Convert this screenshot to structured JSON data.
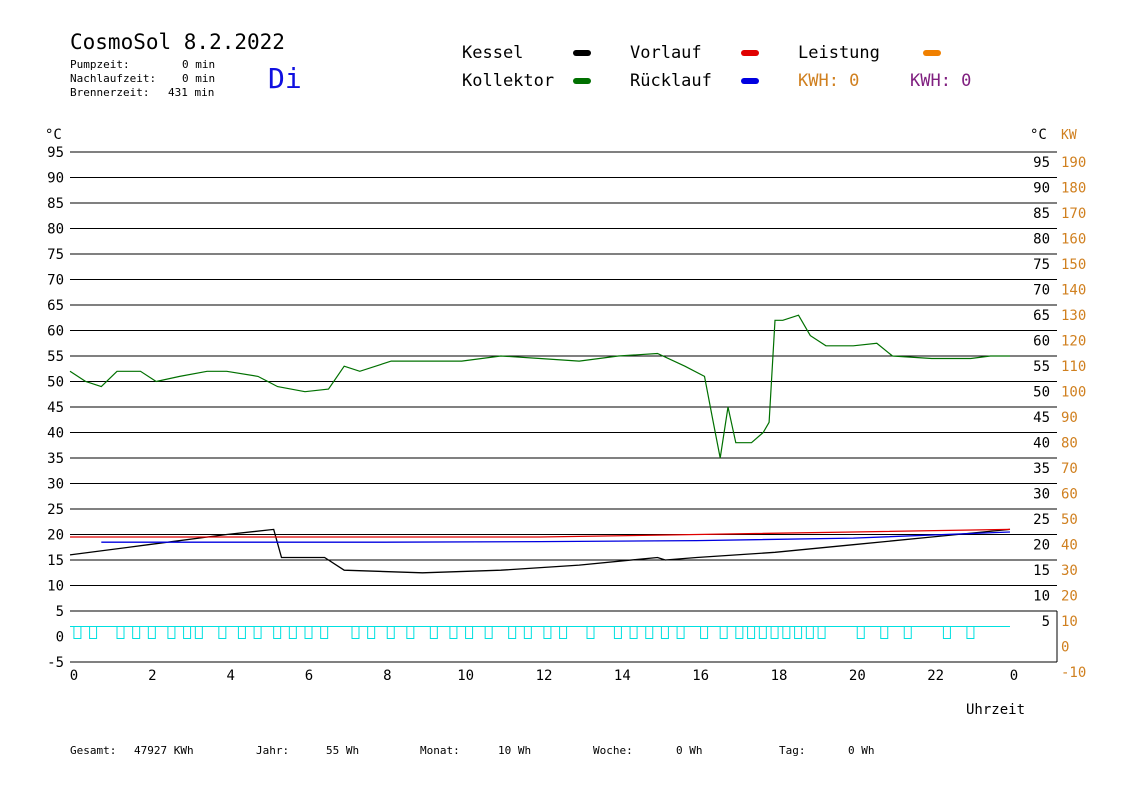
{
  "header": {
    "title": "CosmoSol 8.2.2022",
    "day": "Di",
    "stats": [
      {
        "label": "Pumpzeit:",
        "value": "0 min"
      },
      {
        "label": "Nachlaufzeit:",
        "value": "0 min"
      },
      {
        "label": "Brennerzeit:",
        "value": "431 min"
      }
    ]
  },
  "legend": {
    "kessel": {
      "label": "Kessel",
      "color": "#000000"
    },
    "vorlauf": {
      "label": "Vorlauf",
      "color": "#e00000"
    },
    "leistung": {
      "label": "Leistung",
      "color": "#f08000"
    },
    "kollektor": {
      "label": "Kollektor",
      "color": "#007000"
    },
    "ruecklauf": {
      "label": "Rücklauf",
      "color": "#0000e0"
    },
    "kwh1": {
      "label": "KWH: 0",
      "color": "#d08020"
    },
    "kwh2": {
      "label": "KWH: 0",
      "color": "#802080"
    }
  },
  "footer": [
    {
      "label": "Gesamt:",
      "value": "47927 KWh"
    },
    {
      "label": "Jahr:",
      "value": "55 Wh"
    },
    {
      "label": "Monat:",
      "value": "10 Wh"
    },
    {
      "label": "Woche:",
      "value": "0 Wh"
    },
    {
      "label": "Tag:",
      "value": "0 Wh"
    }
  ],
  "chart_data": {
    "type": "line",
    "xlabel": "Uhrzeit",
    "ylabel_left": "°C",
    "ylabel_right_1": "°C",
    "ylabel_right_2": "KW",
    "xlim": [
      0,
      24
    ],
    "ylim": [
      -5,
      100
    ],
    "x_ticks": [
      "0",
      "2",
      "4",
      "6",
      "8",
      "10",
      "12",
      "14",
      "16",
      "18",
      "20",
      "22",
      "0"
    ],
    "y_ticks_left": [
      95,
      90,
      85,
      80,
      75,
      70,
      65,
      60,
      55,
      50,
      45,
      40,
      35,
      30,
      25,
      20,
      15,
      10,
      5,
      0,
      -5
    ],
    "y_ticks_right_c": [
      95,
      90,
      85,
      80,
      75,
      70,
      65,
      60,
      55,
      50,
      45,
      40,
      35,
      30,
      25,
      20,
      15,
      10,
      5
    ],
    "y_ticks_right_kw": [
      190,
      180,
      170,
      160,
      150,
      140,
      130,
      120,
      110,
      100,
      90,
      80,
      70,
      60,
      50,
      40,
      30,
      20,
      10,
      0,
      -10
    ],
    "grid": true,
    "series": [
      {
        "name": "Kollektor",
        "color": "#007000",
        "x": [
          0,
          0.4,
          0.8,
          1.2,
          1.8,
          2.2,
          2.8,
          3.5,
          4.0,
          4.8,
          5.3,
          6.0,
          6.6,
          7.0,
          7.4,
          8.2,
          9.0,
          10.0,
          11.0,
          12.0,
          13.0,
          14.0,
          15.0,
          15.7,
          16.2,
          16.4,
          16.6,
          16.8,
          17.0,
          17.4,
          17.7,
          17.85,
          18.0,
          18.2,
          18.6,
          18.9,
          19.3,
          20.0,
          20.6,
          21.0,
          22.0,
          23.0,
          23.5,
          24.0
        ],
        "y": [
          52,
          50,
          49,
          52,
          52,
          50,
          51,
          52,
          52,
          51,
          49,
          48,
          48.5,
          53,
          52,
          54,
          54,
          54,
          55,
          54.5,
          54,
          55,
          55.5,
          53,
          51,
          43,
          35,
          45,
          38,
          38,
          40,
          42,
          62,
          62,
          63,
          59,
          57,
          57,
          57.5,
          55,
          54.5,
          54.5,
          55,
          55
        ]
      },
      {
        "name": "Kessel",
        "color": "#000000",
        "x": [
          0,
          2,
          4,
          5.2,
          5.4,
          6.5,
          7.0,
          9.0,
          11.0,
          13.0,
          15.0,
          15.2,
          16.0,
          18.0,
          20.0,
          22.0,
          24.0
        ],
        "y": [
          16,
          18,
          20,
          21,
          15.5,
          15.5,
          13,
          12.5,
          13,
          14,
          15.5,
          15,
          15.5,
          16.5,
          18,
          19.5,
          21
        ]
      },
      {
        "name": "Vorlauf",
        "color": "#e00000",
        "x": [
          0,
          4,
          8,
          12,
          16,
          20,
          24
        ],
        "y": [
          19.5,
          19.5,
          19.5,
          19.5,
          20,
          20.5,
          21
        ]
      },
      {
        "name": "Rücklauf",
        "color": "#0000e0",
        "x": [
          0.8,
          4,
          8,
          12,
          16,
          20,
          24
        ],
        "y": [
          18.5,
          18.5,
          18.5,
          18.6,
          18.8,
          19.3,
          20.5
        ]
      },
      {
        "name": "Leistung",
        "color": "#00e0e0",
        "x": [
          0,
          24
        ],
        "y": [
          0,
          0
        ]
      }
    ],
    "leistung_pulse_hours": [
      0.1,
      0.5,
      1.2,
      1.6,
      2.0,
      2.5,
      2.9,
      3.2,
      3.8,
      4.3,
      4.7,
      5.2,
      5.6,
      6.0,
      6.4,
      7.2,
      7.6,
      8.1,
      8.6,
      9.2,
      9.7,
      10.1,
      10.6,
      11.2,
      11.6,
      12.1,
      12.5,
      13.2,
      13.9,
      14.3,
      14.7,
      15.1,
      15.5,
      16.1,
      16.6,
      17.0,
      17.3,
      17.6,
      17.9,
      18.2,
      18.5,
      18.8,
      19.1,
      20.1,
      20.7,
      21.3,
      22.3,
      22.9
    ]
  }
}
